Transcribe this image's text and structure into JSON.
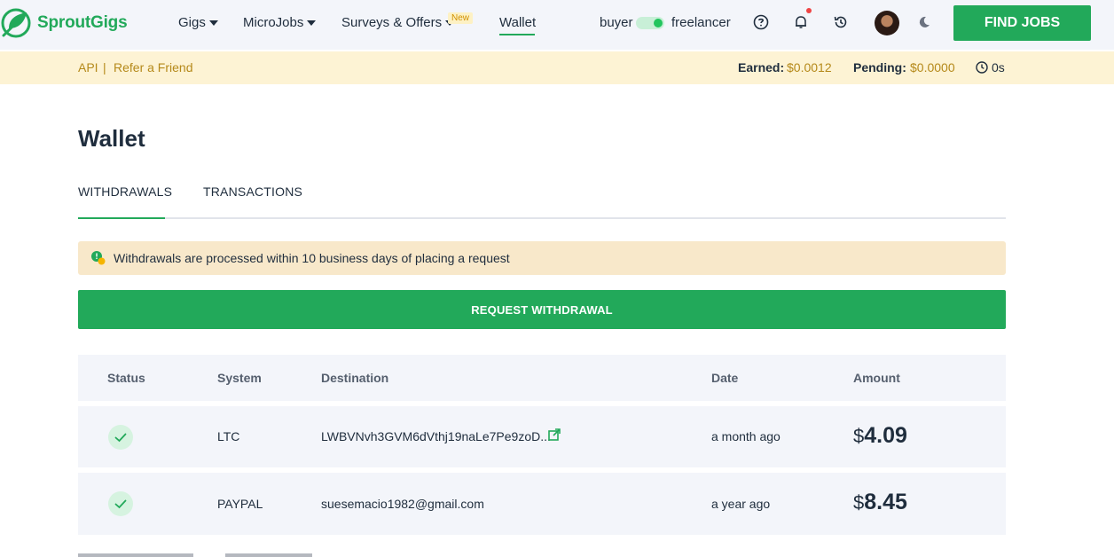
{
  "brand": {
    "name": "SproutGigs"
  },
  "nav": {
    "items": [
      {
        "label": "Gigs"
      },
      {
        "label": "MicroJobs"
      },
      {
        "label": "Surveys & Offers"
      },
      {
        "label": "Wallet"
      }
    ],
    "new_badge": "New",
    "role_left": "buyer",
    "role_right": "freelancer",
    "find_jobs": "FIND JOBS",
    "icons": [
      "help-icon",
      "bell-icon",
      "history-icon",
      "avatar",
      "moon-icon"
    ]
  },
  "earnbar": {
    "api": "API",
    "separator": "|",
    "refer": "Refer a Friend",
    "earned_label": "Earned:",
    "earned_value": "$0.0012",
    "pending_label": "Pending:",
    "pending_value": "$0.0000",
    "timer": "0s"
  },
  "page": {
    "title": "Wallet",
    "tabs": [
      {
        "label": "WITHDRAWALS",
        "active": true
      },
      {
        "label": "TRANSACTIONS",
        "active": false
      }
    ],
    "notice": "Withdrawals are processed within 10 business days of placing a request",
    "request_button": "REQUEST WITHDRAWAL"
  },
  "table": {
    "headers": [
      "Status",
      "System",
      "Destination",
      "Date",
      "Amount"
    ],
    "rows": [
      {
        "status": "completed",
        "system": "LTC",
        "destination": "LWBVNvh3GVM6dVthj19naLe7Pe9zoD...",
        "date": "a month ago",
        "currency": "$",
        "amount": "4.09"
      },
      {
        "status": "completed",
        "system": "PAYPAL",
        "destination": "suesemacio1982@gmail.com",
        "date": "a year ago",
        "currency": "$",
        "amount": "8.45"
      }
    ]
  },
  "colors": {
    "brand_green": "#22a95a",
    "gold": "#b5891a",
    "notice_bg": "#f8e8ca"
  }
}
